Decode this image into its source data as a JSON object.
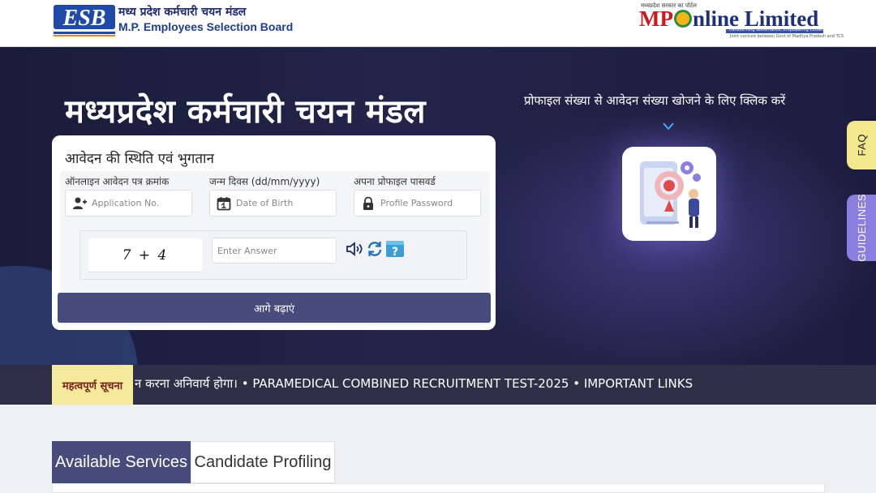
{
  "header": {
    "esb_logo_text": "ESB",
    "esb_name_hindi": "मध्य प्रदेश कर्मचारी चयन मंडल",
    "esb_name_english": "M.P. Employees Selection Board",
    "mp_tagline": "मध्यप्रदेश सरकार का पोर्टल",
    "mp_brand_red": "MP",
    "mp_brand_blue": "nline Limited",
    "mp_slogan": "Transforming Governance, Empowering Citizens",
    "mp_sub": "Joint venture between Govt of Madhya Pradesh and TCS"
  },
  "hero": {
    "title": "मध्यप्रदेश कर्मचारी चयन मंडल",
    "profile_hint": "प्रोफाइल संख्या से आवेदन संख्या खोजने के लिए क्लिक करें"
  },
  "form": {
    "title": "आवेदन की स्थिति एवं भुगतान",
    "fields": [
      {
        "label": "ऑनलाइन आवेदन पत्र क्रमांक",
        "placeholder": "Application No.",
        "value": ""
      },
      {
        "label": "जन्म दिवस (dd/mm/yyyy)",
        "placeholder": "Date of Birth",
        "value": ""
      },
      {
        "label": "अपना प्रोफाइल पासवर्ड",
        "placeholder": "Profile Password",
        "value": ""
      }
    ],
    "captcha": {
      "question": "7 + 4",
      "placeholder": "Enter Answer",
      "value": ""
    },
    "submit_label": "आगे बढ़ाएं"
  },
  "side_tabs": {
    "faq": "FAQ",
    "guidelines": "GUIDELINES"
  },
  "ticker": {
    "label": "महत्वपूर्ण सूचना",
    "text": "न करना अनिवार्य होगा। • PARAMEDICAL COMBINED RECRUITMENT TEST-2025 • IMPORTANT LINKS"
  },
  "tabs": [
    {
      "label": "Available Services",
      "active": true
    },
    {
      "label": "Candidate Profiling",
      "active": false
    }
  ],
  "colors": {
    "primary": "#474c7c",
    "hero_bg": "#1e2044",
    "faq_tab": "#f4e88c",
    "guidelines_tab": "#8b7ee0",
    "ticker_label_bg": "#f5ea9c",
    "ticker_bg": "#2f3048",
    "brand_red": "#d2161e",
    "brand_blue": "#1f2f7a"
  },
  "icons": {
    "application_field": "user-plus-icon",
    "dob_field": "calendar-icon",
    "password_field": "lock-icon",
    "captcha_audio": "speaker-icon",
    "captcha_refresh": "refresh-icon",
    "captcha_help": "help-icon",
    "profile_card": "profile-search-illustration"
  }
}
